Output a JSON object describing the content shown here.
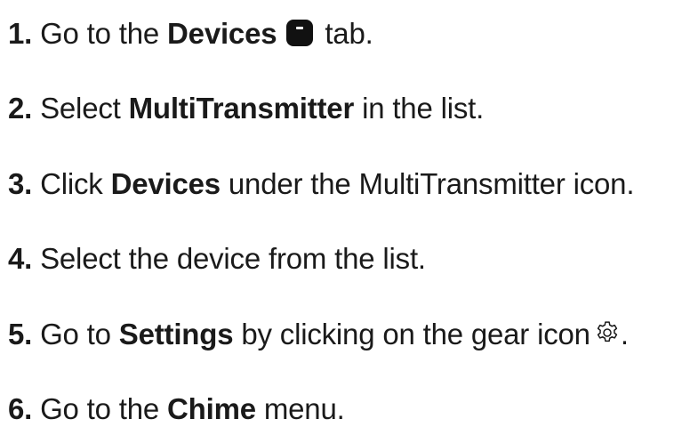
{
  "steps": [
    {
      "num": "1.",
      "pre": " Go to the ",
      "bold": "Devices",
      "post": " tab."
    },
    {
      "num": "2.",
      "pre": " Select ",
      "bold": "MultiTransmitter",
      "post": " in the list."
    },
    {
      "num": "3.",
      "pre": " Click ",
      "bold": "Devices",
      "post": " under the MultiTransmitter icon."
    },
    {
      "num": "4.",
      "pre": " Select the device from the list.",
      "bold": "",
      "post": ""
    },
    {
      "num": "5.",
      "pre": " Go to ",
      "bold": "Settings",
      "post": " by clicking on the gear icon",
      "tail": "."
    },
    {
      "num": "6.",
      "pre": " Go to the ",
      "bold": "Chime",
      "post": " menu."
    }
  ],
  "icons": {
    "devices_tab": "devices-tab-icon",
    "settings": "gear-icon"
  }
}
